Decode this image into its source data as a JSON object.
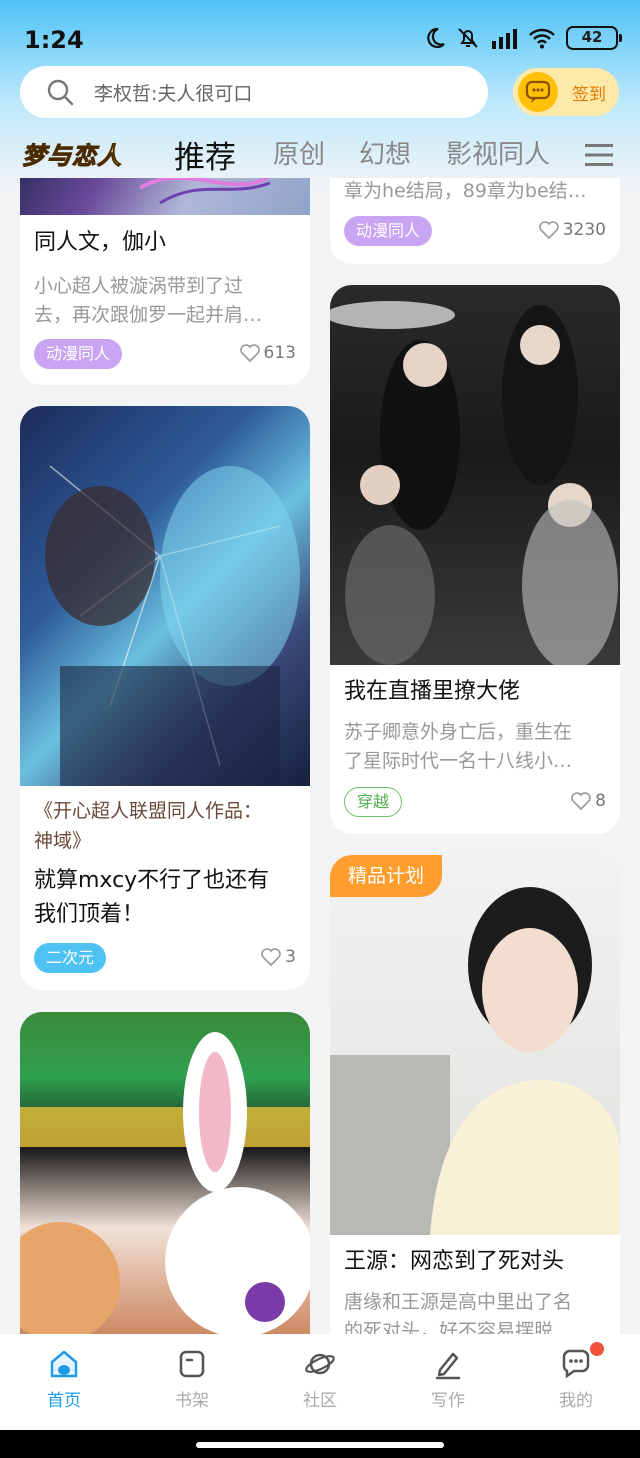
{
  "status": {
    "time": "1:24",
    "battery": "42"
  },
  "search": {
    "placeholder": "李权哲:夫人很可口"
  },
  "checkin": {
    "label": "签到"
  },
  "tabs": {
    "logo": "梦与恋人",
    "items": [
      "推荐",
      "原创",
      "幻想",
      "影视同人"
    ]
  },
  "cards": {
    "c1": {
      "title": "同人文，伽小",
      "desc1": "小心超人被漩涡带到了过",
      "desc2": "去，再次跟伽罗一起并肩…",
      "tag": "动漫同人",
      "likes": "613"
    },
    "c2": {
      "desc": "章为he结局，89章为be结…",
      "tag": "动漫同人",
      "likes": "3230"
    },
    "c3": {
      "quote1": "《开心超人联盟同人作品：",
      "quote2": "神域》",
      "title1": "就算mxcy不行了也还有",
      "title2": "我们顶着！",
      "tag": "二次元",
      "likes": "3"
    },
    "c4": {
      "title": "我在直播里撩大佬",
      "desc1": "苏子卿意外身亡后，重生在",
      "desc2": "了星际时代一名十八线小…",
      "tag": "穿越",
      "likes": "8"
    },
    "c5": {
      "badge": "精品计划",
      "title": "王源：网恋到了死对头",
      "desc1": "唐缘和王源是高中里出了名",
      "desc2": "的死对头，好不容易摆脱"
    }
  },
  "nav": {
    "home": "首页",
    "shelf": "书架",
    "community": "社区",
    "write": "写作",
    "mine": "我的"
  },
  "colors": {
    "accent": "#1e9be8",
    "premium": "#ff9d2e",
    "tag_anime": "#c9a4f2",
    "tag_2d": "#4ec2f2"
  }
}
